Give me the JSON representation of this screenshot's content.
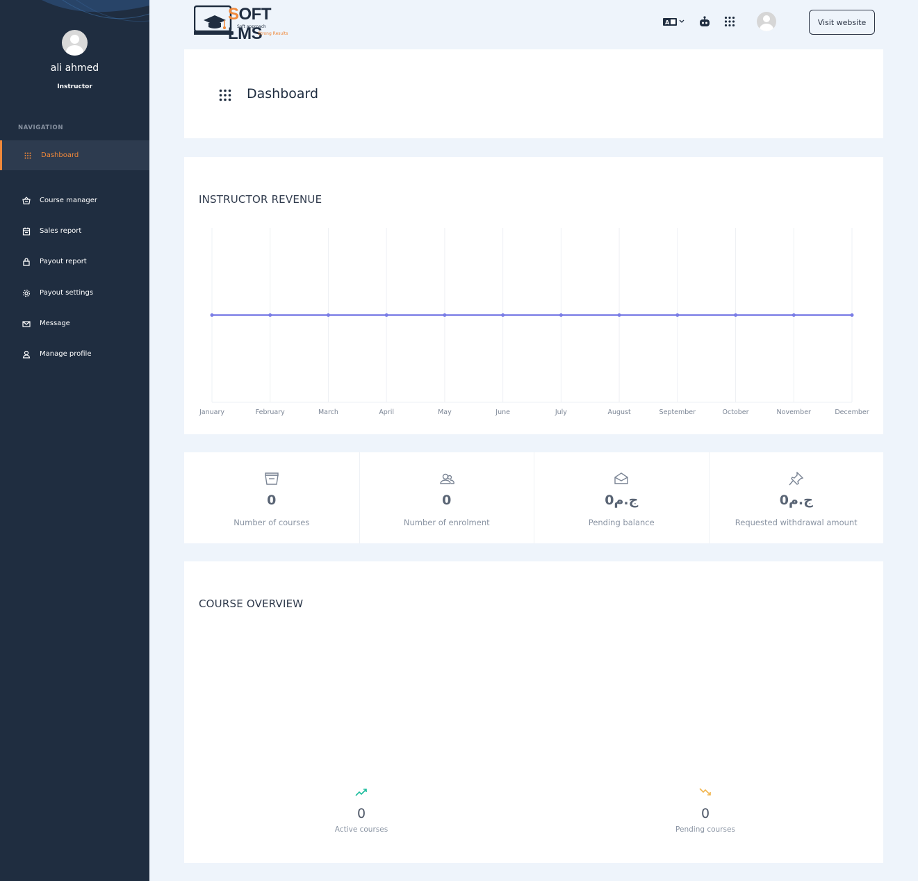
{
  "sidebar": {
    "user_name": "ali ahmed",
    "user_role": "Instructor",
    "nav_heading": "NAVIGATION",
    "items": [
      {
        "label": "Dashboard",
        "icon": "grid-icon",
        "active": true
      },
      {
        "label": "Course manager",
        "icon": "basket-icon",
        "active": false
      },
      {
        "label": "Sales report",
        "icon": "calendar-icon",
        "active": false
      },
      {
        "label": "Payout report",
        "icon": "bag-icon",
        "active": false
      },
      {
        "label": "Payout settings",
        "icon": "gear-icon",
        "active": false
      },
      {
        "label": "Message",
        "icon": "mail-icon",
        "active": false
      },
      {
        "label": "Manage profile",
        "icon": "user-icon",
        "active": false
      }
    ],
    "active_color": "#f0883a",
    "background": "#1f2d40"
  },
  "header": {
    "logo_title": "SOFT LMS",
    "logo_tagline_1": "Soft approach",
    "logo_tagline_2": "Strong Results",
    "language_icon": "language-icon",
    "robot_icon": "robot-icon",
    "apps_icon": "apps-grid-icon",
    "visit_website": "Visit website"
  },
  "page": {
    "title": "Dashboard"
  },
  "revenue": {
    "title": "INSTRUCTOR REVENUE"
  },
  "chart_data": {
    "type": "line",
    "title": "INSTRUCTOR REVENUE",
    "categories": [
      "January",
      "February",
      "March",
      "April",
      "May",
      "June",
      "July",
      "August",
      "September",
      "October",
      "November",
      "December"
    ],
    "series": [
      {
        "values": [
          0,
          0,
          0,
          0,
          0,
          0,
          0,
          0,
          0,
          0,
          0,
          0
        ],
        "color": "#7b7ee6"
      }
    ],
    "grid": true
  },
  "stats": [
    {
      "icon": "basket-icon",
      "value": "0",
      "label": "Number of courses"
    },
    {
      "icon": "users-icon",
      "value": "0",
      "label": "Number of enrolment"
    },
    {
      "icon": "inbox-icon",
      "value": "0ج.م",
      "label": "Pending balance"
    },
    {
      "icon": "pin-icon",
      "value": "0ج.م",
      "label": "Requested withdrawal amount"
    }
  ],
  "overview": {
    "title": "COURSE OVERVIEW",
    "active": {
      "icon": "trend-up-icon",
      "value": "0",
      "label": "Active courses",
      "color": "#1abc9c"
    },
    "pending": {
      "icon": "trend-down-icon",
      "value": "0",
      "label": "Pending courses",
      "color": "#f1b44c"
    }
  }
}
